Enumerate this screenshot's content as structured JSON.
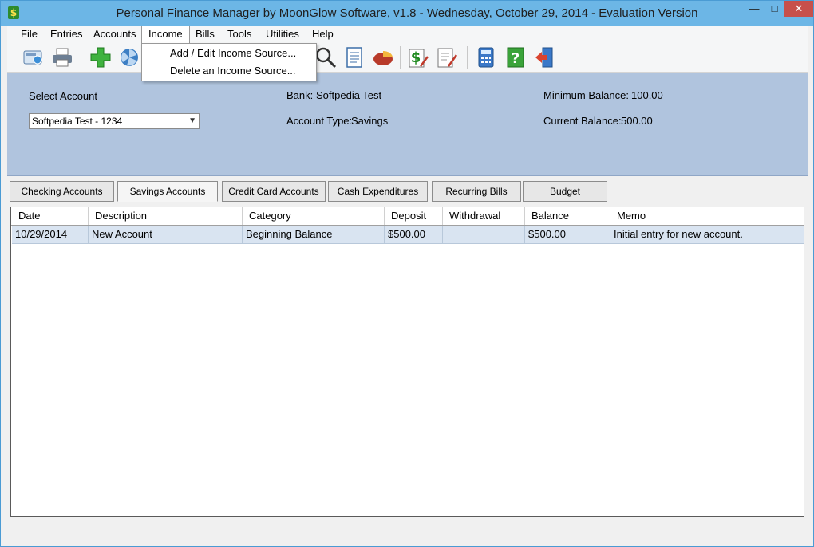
{
  "window": {
    "title": "Personal Finance Manager by MoonGlow Software, v1.8  -  Wednesday, October 29, 2014  -  Evaluation Version",
    "minimize": "—",
    "maximize": "□",
    "close": "✕"
  },
  "menu": {
    "items": [
      "File",
      "Entries",
      "Accounts",
      "Income",
      "Bills",
      "Tools",
      "Utilities",
      "Help"
    ],
    "open_item": "Income",
    "dropdown": [
      "Add / Edit Income Source...",
      "Delete an Income Source..."
    ]
  },
  "toolbar": {
    "icons": [
      "view-account-icon",
      "print-icon",
      "add-entry-icon",
      "fan-icon",
      "search-icon",
      "document-icon",
      "pie-chart-icon",
      "money-edit-icon",
      "report-edit-icon",
      "calculator-icon",
      "help-icon",
      "exit-icon"
    ]
  },
  "account_panel": {
    "select_label": "Select Account",
    "selected_account": "Softpedia Test - 1234",
    "bank_label": "Bank:",
    "bank_value": "Softpedia Test",
    "type_label": "Account Type:",
    "type_value": "Savings",
    "min_balance_label": "Minimum Balance:",
    "min_balance_value": "100.00",
    "current_balance_label": "Current Balance:",
    "current_balance_value": "500.00"
  },
  "tabs": {
    "items": [
      "Checking Accounts",
      "Savings Accounts",
      "Credit Card Accounts",
      "Cash Expenditures",
      "Recurring Bills",
      "Budget"
    ],
    "active": "Savings Accounts"
  },
  "table": {
    "columns": [
      "Date",
      "Description",
      "Category",
      "Deposit",
      "Withdrawal",
      "Balance",
      "Memo"
    ],
    "rows": [
      [
        "10/29/2014",
        "New Account",
        "Beginning Balance",
        "$500.00",
        "",
        "$500.00",
        "Initial entry for new account."
      ]
    ]
  },
  "colors": {
    "panel_bg": "#b0c4de",
    "titlebar": "#6cb6e6",
    "selected_row": "#d9e4f1",
    "close_button": "#c7504b"
  }
}
